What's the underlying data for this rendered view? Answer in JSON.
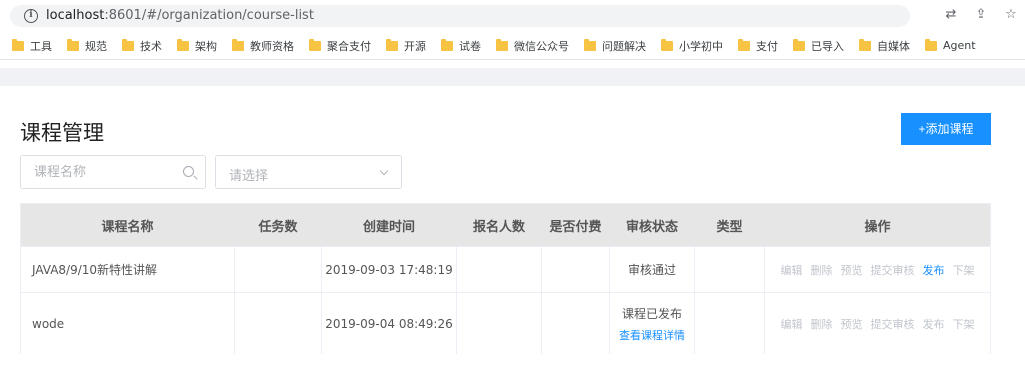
{
  "browser": {
    "url_host": "localhost",
    "url_path": ":8601/#/organization/course-list",
    "bookmarks": [
      "工具",
      "规范",
      "技术",
      "架构",
      "教师资格",
      "聚合支付",
      "开源",
      "试卷",
      "微信公众号",
      "问题解决",
      "小学初中",
      "支付",
      "已导入",
      "自媒体",
      "Agent"
    ]
  },
  "page": {
    "title": "课程管理",
    "add_button": "+添加课程",
    "search_placeholder": "课程名称",
    "select_placeholder": "请选择"
  },
  "table": {
    "headers": [
      "课程名称",
      "任务数",
      "创建时间",
      "报名人数",
      "是否付费",
      "审核状态",
      "类型",
      "操作"
    ],
    "rows": [
      {
        "name": "JAVA8/9/10新特性讲解",
        "tasks": "",
        "created": "2019-09-03 17:48:19",
        "enrolled": "",
        "paid": "",
        "status": "审核通过",
        "status_link": "",
        "type": "",
        "ops": [
          "编辑",
          "删除",
          "预览",
          "提交审核",
          "发布",
          "下架"
        ],
        "ops_active": [
          false,
          false,
          false,
          false,
          true,
          false
        ]
      },
      {
        "name": "wode",
        "tasks": "",
        "created": "2019-09-04 08:49:26",
        "enrolled": "",
        "paid": "",
        "status": "课程已发布",
        "status_link": "查看课程详情",
        "type": "",
        "ops": [
          "编辑",
          "删除",
          "预览",
          "提交审核",
          "发布",
          "下架"
        ],
        "ops_active": [
          false,
          false,
          false,
          false,
          false,
          false
        ]
      }
    ]
  },
  "colors": {
    "primary": "#1890ff",
    "header_bg": "#e6e6e6",
    "disabled_text": "#c0c4cc"
  }
}
